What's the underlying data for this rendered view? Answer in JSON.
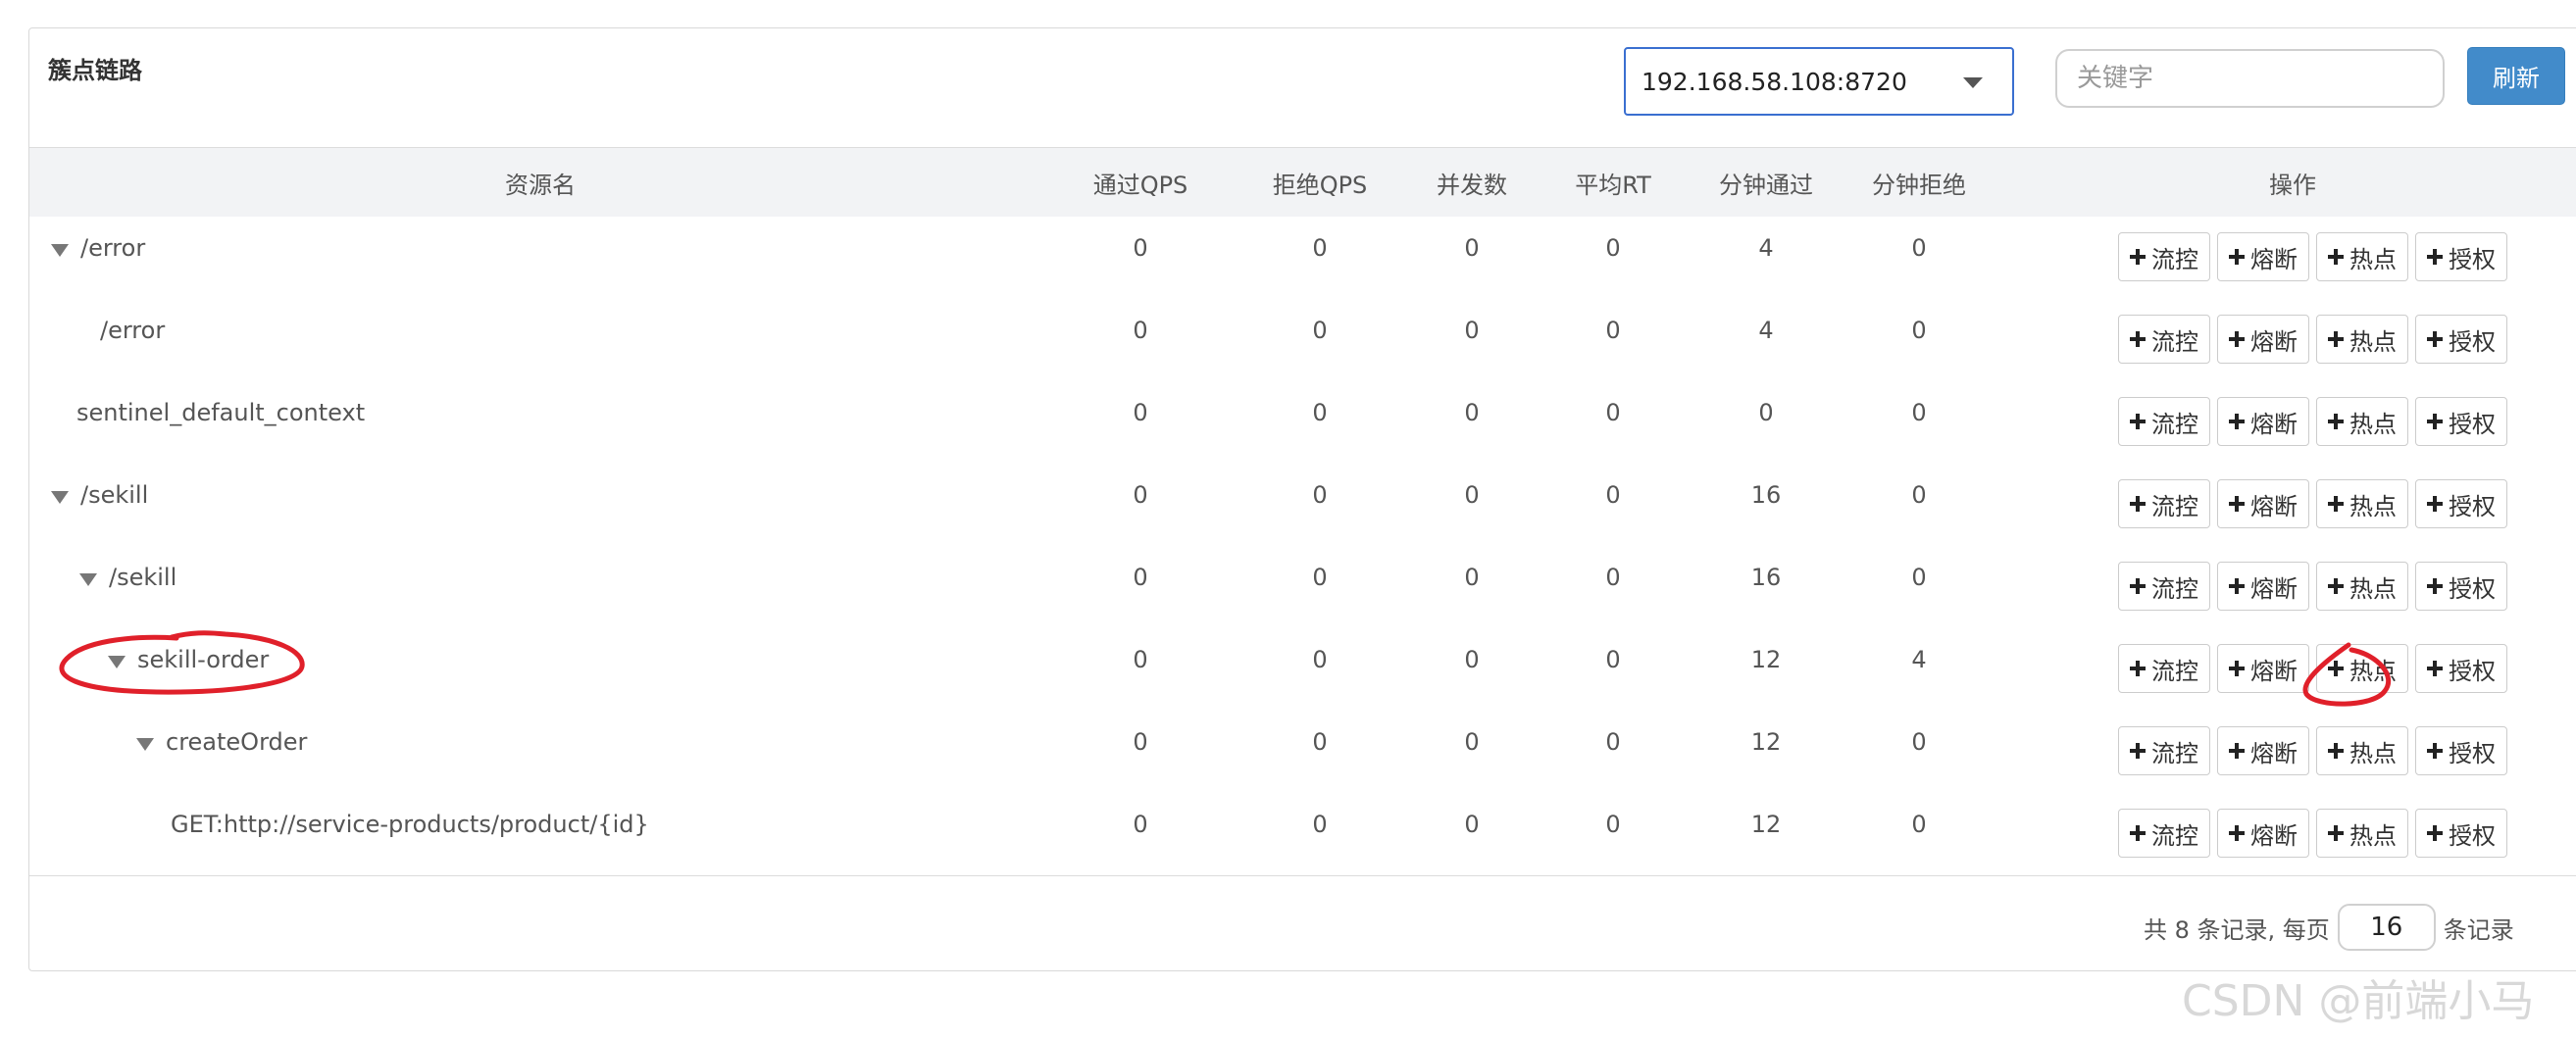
{
  "panel": {
    "title": "簇点链路"
  },
  "toolbar": {
    "machine_selected": "192.168.58.108:8720",
    "search_placeholder": "关键字",
    "refresh_label": "刷新"
  },
  "columns": [
    "资源名",
    "通过QPS",
    "拒绝QPS",
    "并发数",
    "平均RT",
    "分钟通过",
    "分钟拒绝",
    "操作"
  ],
  "action_labels": [
    "流控",
    "熔断",
    "热点",
    "授权"
  ],
  "rows": [
    {
      "name": "/error",
      "depth": 0,
      "expandable": true,
      "pass_qps": "0",
      "block_qps": "0",
      "concurrency": "0",
      "avg_rt": "0",
      "minute_pass": "4",
      "minute_block": "0"
    },
    {
      "name": "/error",
      "depth": 1,
      "expandable": false,
      "pass_qps": "0",
      "block_qps": "0",
      "concurrency": "0",
      "avg_rt": "0",
      "minute_pass": "4",
      "minute_block": "0"
    },
    {
      "name": "sentinel_default_context",
      "depth": 0,
      "expandable": false,
      "pass_qps": "0",
      "block_qps": "0",
      "concurrency": "0",
      "avg_rt": "0",
      "minute_pass": "0",
      "minute_block": "0"
    },
    {
      "name": "/sekill",
      "depth": 0,
      "expandable": true,
      "pass_qps": "0",
      "block_qps": "0",
      "concurrency": "0",
      "avg_rt": "0",
      "minute_pass": "16",
      "minute_block": "0"
    },
    {
      "name": "/sekill",
      "depth": 1,
      "expandable": true,
      "pass_qps": "0",
      "block_qps": "0",
      "concurrency": "0",
      "avg_rt": "0",
      "minute_pass": "16",
      "minute_block": "0"
    },
    {
      "name": "sekill-order",
      "depth": 2,
      "expandable": true,
      "pass_qps": "0",
      "block_qps": "0",
      "concurrency": "0",
      "avg_rt": "0",
      "minute_pass": "12",
      "minute_block": "4"
    },
    {
      "name": "createOrder",
      "depth": 3,
      "expandable": true,
      "pass_qps": "0",
      "block_qps": "0",
      "concurrency": "0",
      "avg_rt": "0",
      "minute_pass": "12",
      "minute_block": "0"
    },
    {
      "name": "GET:http://service-products/product/{id}",
      "depth": 4,
      "expandable": false,
      "pass_qps": "0",
      "block_qps": "0",
      "concurrency": "0",
      "avg_rt": "0",
      "minute_pass": "12",
      "minute_block": "0"
    }
  ],
  "pager": {
    "prefix": "共 8 条记录, 每页",
    "page_size": "16",
    "suffix": "条记录"
  },
  "watermark": "CSDN @前端小马",
  "colors": {
    "primary": "#428bca",
    "select_border": "#3a6fd0",
    "annotation": "#e0202a"
  }
}
